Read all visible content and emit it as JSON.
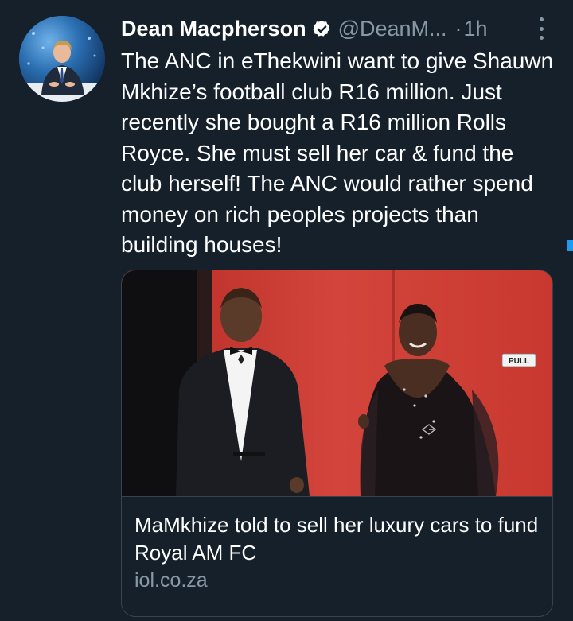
{
  "author": {
    "name": "Dean Macpherson",
    "handle": "@DeanM...",
    "time_separator": "·",
    "timestamp": "1h",
    "avatar_icon": "user-avatar-photo",
    "verified_icon": "verified-badge-icon"
  },
  "tweet": {
    "text": "The ANC in eThekwini want to give Shauwn Mkhize’s football club R16 million. Just recently she bought a R16 million Rolls Royce. She must sell her car & fund the club herself! The ANC would rather spend money on rich peoples projects than building houses!"
  },
  "link_card": {
    "image_sign_text": "PULL",
    "title": "MaMkhize told to sell her luxury cars to fund Royal AM FC",
    "domain": "iol.co.za"
  },
  "colors": {
    "background": "#15202b",
    "primary_text": "#ffffff",
    "secondary_text": "#8899a6",
    "border": "#38444d",
    "accent": "#1d9bf0"
  }
}
